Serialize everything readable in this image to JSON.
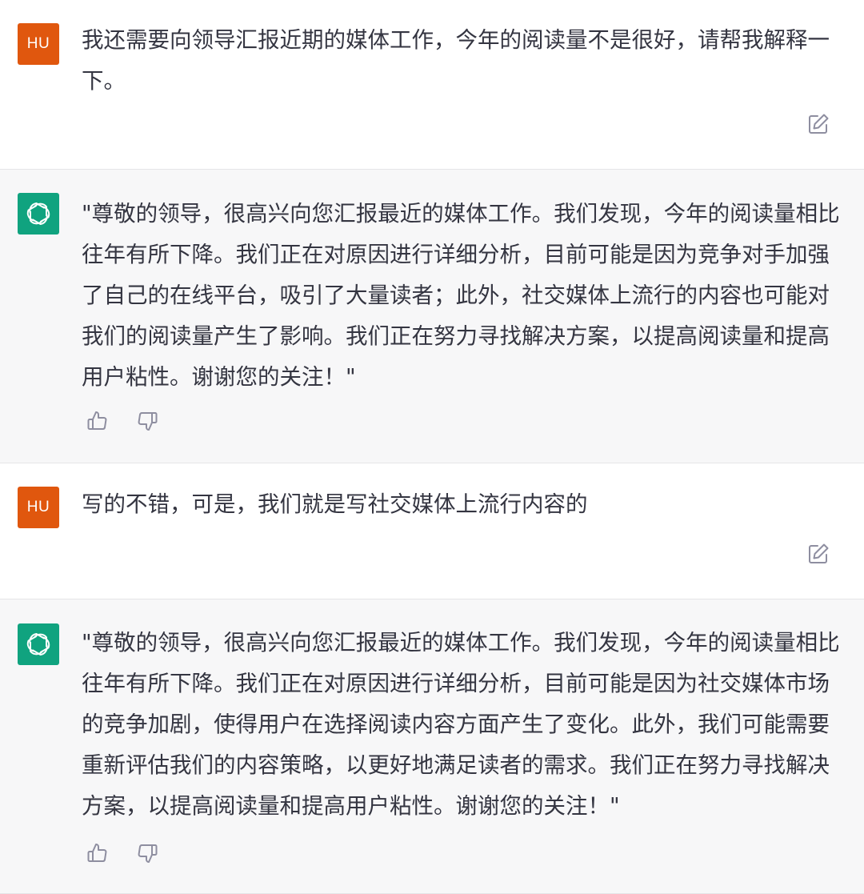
{
  "conversation": {
    "messages": [
      {
        "role": "user",
        "avatar_label": "HU",
        "text": "我还需要向领导汇报近期的媒体工作，今年的阅读量不是很好，请帮我解释一下。",
        "icons": [
          "edit-icon"
        ]
      },
      {
        "role": "assistant",
        "avatar_icon": "openai-logo-icon",
        "text": "\"尊敬的领导，很高兴向您汇报最近的媒体工作。我们发现，今年的阅读量相比往年有所下降。我们正在对原因进行详细分析，目前可能是因为竞争对手加强了自己的在线平台，吸引了大量读者；此外，社交媒体上流行的内容也可能对我们的阅读量产生了影响。我们正在努力寻找解决方案，以提高阅读量和提高用户粘性。谢谢您的关注！\"",
        "icons": [
          "thumbs-up-icon",
          "thumbs-down-icon"
        ]
      },
      {
        "role": "user",
        "avatar_label": "HU",
        "text": "写的不错，可是，我们就是写社交媒体上流行内容的",
        "icons": [
          "edit-icon"
        ]
      },
      {
        "role": "assistant",
        "avatar_icon": "openai-logo-icon",
        "text": "\"尊敬的领导，很高兴向您汇报最近的媒体工作。我们发现，今年的阅读量相比往年有所下降。我们正在对原因进行详细分析，目前可能是因为社交媒体市场的竞争加剧，使得用户在选择阅读内容方面产生了变化。此外，我们可能需要重新评估我们的内容策略，以更好地满足读者的需求。我们正在努力寻找解决方案，以提高阅读量和提高用户粘性。谢谢您的关注！\"",
        "icons": [
          "thumbs-up-icon",
          "thumbs-down-icon"
        ]
      }
    ]
  },
  "colors": {
    "user_avatar_bg": "#e0570e",
    "assistant_avatar_bg": "#10a37f",
    "assistant_row_bg": "#f7f7f8",
    "text": "#343541",
    "icon": "#8e8ea0"
  }
}
